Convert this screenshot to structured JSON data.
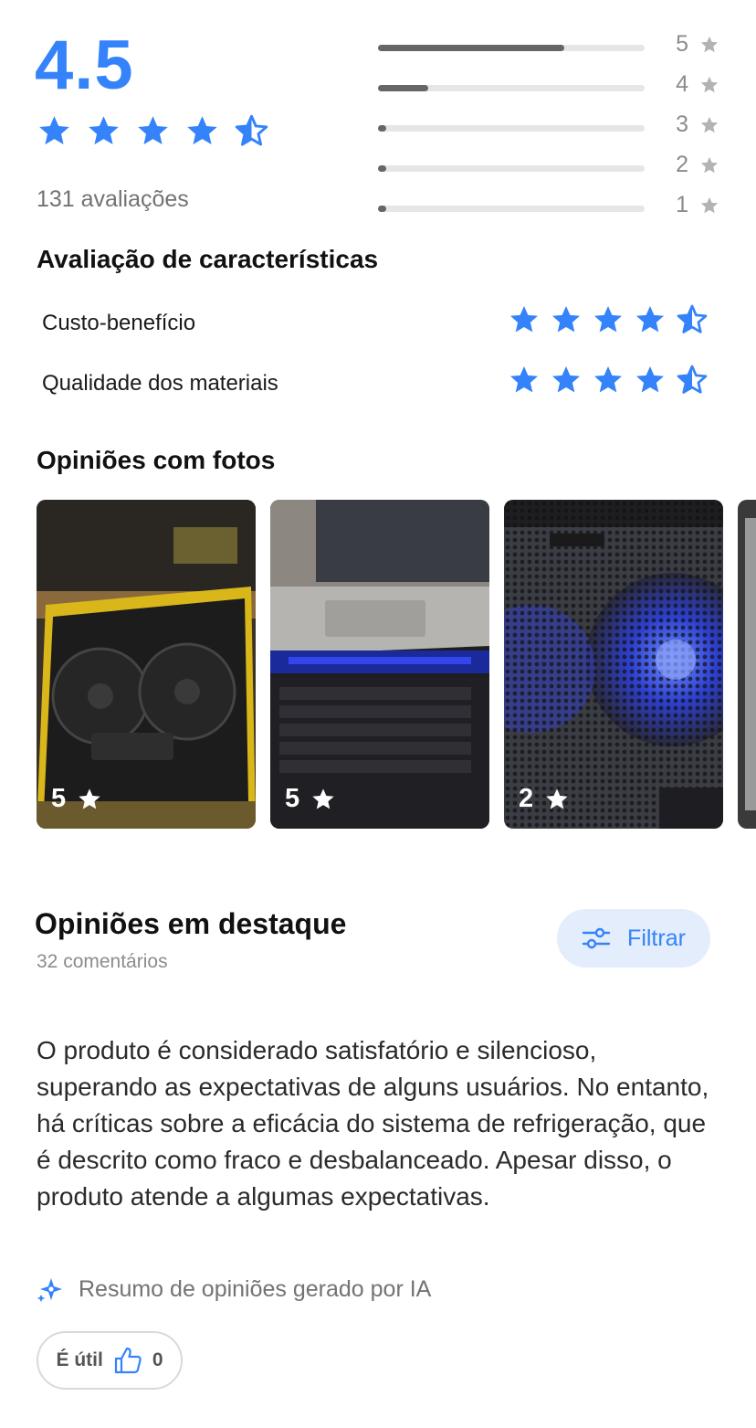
{
  "rating": {
    "average": "4.5",
    "stars_value": 4.5,
    "total_label": "131 avaliações",
    "distribution": [
      {
        "stars": "5",
        "fill_fraction": 0.7
      },
      {
        "stars": "4",
        "fill_fraction": 0.19
      },
      {
        "stars": "3",
        "fill_fraction": 0.02
      },
      {
        "stars": "2",
        "fill_fraction": 0.02
      },
      {
        "stars": "1",
        "fill_fraction": 0.02
      }
    ]
  },
  "characteristics": {
    "title": "Avaliação de características",
    "items": [
      {
        "label": "Custo-benefício",
        "stars_value": 4.5
      },
      {
        "label": "Qualidade dos materiais",
        "stars_value": 4.5
      }
    ]
  },
  "photos": {
    "title": "Opiniões com fotos",
    "items": [
      {
        "rating": "5",
        "icon": "laptop-cooler-yellow-photo"
      },
      {
        "rating": "5",
        "icon": "laptop-on-cooler-photo"
      },
      {
        "rating": "2",
        "icon": "cooler-blue-fans-photo"
      }
    ]
  },
  "featured": {
    "title": "Opiniões em destaque",
    "count_label": "32 comentários",
    "filter_label": "Filtrar",
    "summary": "O produto é considerado satisfatório e silencioso, superando as expectativas de alguns usuários. No entanto, há críticas sobre a eficácia do sistema de refrigeração, que é descrito como fraco e desbalanceado. Apesar disso, o produto atende a algumas expectativas.",
    "ai_note": "Resumo de opiniões gerado por IA",
    "useful_label": "É útil",
    "useful_count": "0"
  },
  "colors": {
    "accent": "#3483fa",
    "bar_fill": "#666666",
    "bar_track": "#e6e6e6",
    "muted_text": "#8c8c8c",
    "filter_bg": "#e3edfb"
  }
}
